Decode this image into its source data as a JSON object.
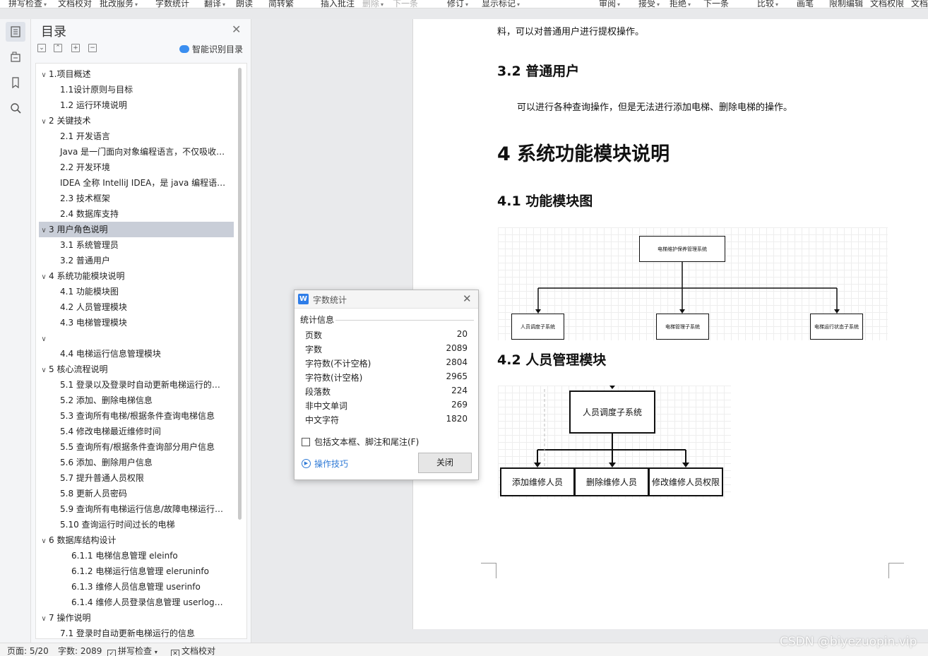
{
  "toolbar": {
    "items": [
      "拼写检查",
      "文档校对",
      "批改服务",
      "字数统计",
      "翻译",
      "朗读",
      "简转繁",
      "插入批注",
      "删除",
      "下一条",
      "修订",
      "显示标记",
      "审阅",
      "接受",
      "拒绝",
      "下一条",
      "比较",
      "画笔",
      "限制编辑",
      "文档权限",
      "文档"
    ]
  },
  "toc": {
    "title": "目录",
    "smart_label": "智能识别目录",
    "items": [
      {
        "text": "1.项目概述",
        "chev": "∨"
      },
      {
        "text": "1.1设计原则与目标",
        "chev": ""
      },
      {
        "text": "1.2  运行环境说明",
        "chev": ""
      },
      {
        "text": "2  关键技术",
        "chev": "∨"
      },
      {
        "text": "2.1  开发语言",
        "chev": ""
      },
      {
        "text": "Java 是一门面向对象编程语言，不仅吸收…",
        "chev": ""
      },
      {
        "text": "2.2  开发环境",
        "chev": ""
      },
      {
        "text": "IDEA  全称  IntelliJ IDEA，是 java 编程语…",
        "chev": ""
      },
      {
        "text": "2.3  技术框架",
        "chev": ""
      },
      {
        "text": "2.4  数据库支持",
        "chev": ""
      },
      {
        "text": "3  用户角色说明",
        "chev": "∨"
      },
      {
        "text": "3.1  系统管理员",
        "chev": ""
      },
      {
        "text": "3.2  普通用户",
        "chev": ""
      },
      {
        "text": "4  系统功能模块说明",
        "chev": "∨"
      },
      {
        "text": "4.1  功能模块图",
        "chev": ""
      },
      {
        "text": "4.2  人员管理模块",
        "chev": ""
      },
      {
        "text": "4.3  电梯管理模块",
        "chev": ""
      },
      {
        "text": "",
        "chev": "∨"
      },
      {
        "text": "4.4  电梯运行信息管理模块",
        "chev": ""
      },
      {
        "text": "5  核心流程说明",
        "chev": "∨"
      },
      {
        "text": "5.1  登录以及登录时自动更新电梯运行的…",
        "chev": ""
      },
      {
        "text": "5.2  添加、删除电梯信息",
        "chev": ""
      },
      {
        "text": "5.3  查询所有电梯/根据条件查询电梯信息",
        "chev": ""
      },
      {
        "text": "5.4  修改电梯最近维修时间",
        "chev": ""
      },
      {
        "text": "5.5  查询所有/根据条件查询部分用户信息",
        "chev": ""
      },
      {
        "text": "5.6  添加、删除用户信息",
        "chev": ""
      },
      {
        "text": "5.7  提升普通人员权限",
        "chev": ""
      },
      {
        "text": "5.8  更新人员密码",
        "chev": ""
      },
      {
        "text": "5.9  查询所有电梯运行信息/故障电梯运行…",
        "chev": ""
      },
      {
        "text": "5.10  查询运行时间过长的电梯",
        "chev": ""
      },
      {
        "text": "6  数据库结构设计",
        "chev": "∨"
      },
      {
        "text": "6.1.1  电梯信息管理  eleinfo",
        "chev": ""
      },
      {
        "text": "6.1.2  电梯运行信息管理  eleruninfo",
        "chev": ""
      },
      {
        "text": "6.1.3  维修人员信息管理  userinfo",
        "chev": ""
      },
      {
        "text": "6.1.4  维修人员登录信息管理  userlog…",
        "chev": ""
      },
      {
        "text": "7  操作说明",
        "chev": "∨"
      },
      {
        "text": "7.1  登录时自动更新电梯运行的信息",
        "chev": ""
      }
    ]
  },
  "doc": {
    "line_top": "料，可以对普通用户进行提权操作。",
    "h_3_2": "3.2  普通用户",
    "para_3_2": "可以进行各种查询操作，但是无法进行添加电梯、删除电梯的操作。",
    "h_4": "4  系统功能模块说明",
    "h_4_1": "4.1  功能模块图",
    "h_4_2": "4.2  人员管理模块",
    "diagram1": {
      "root": "电梯维护保养管理系统",
      "children": [
        "人员调度子系统",
        "电梯管理子系统",
        "电梯运行状态子系统"
      ]
    },
    "diagram2": {
      "root": "人员调度子系统",
      "children": [
        "添加维修人员",
        "删除维修人员",
        "修改维修人员权限"
      ]
    }
  },
  "dialog": {
    "title": "字数统计",
    "section": "统计信息",
    "stats": [
      {
        "label": "页数",
        "value": "20"
      },
      {
        "label": "字数",
        "value": "2089"
      },
      {
        "label": "字符数(不计空格)",
        "value": "2804"
      },
      {
        "label": "字符数(计空格)",
        "value": "2965"
      },
      {
        "label": "段落数",
        "value": "224"
      },
      {
        "label": "非中文单词",
        "value": "269"
      },
      {
        "label": "中文字符",
        "value": "1820"
      }
    ],
    "checkbox_label": "包括文本框、脚注和尾注(F)",
    "tips_label": "操作技巧",
    "close_label": "关闭"
  },
  "status": {
    "page": "页面: 5/20",
    "words": "字数: 2089",
    "spell": "拼写检查",
    "proof": "文档校对"
  },
  "watermark": "CSDN @biyezuopin.vip"
}
